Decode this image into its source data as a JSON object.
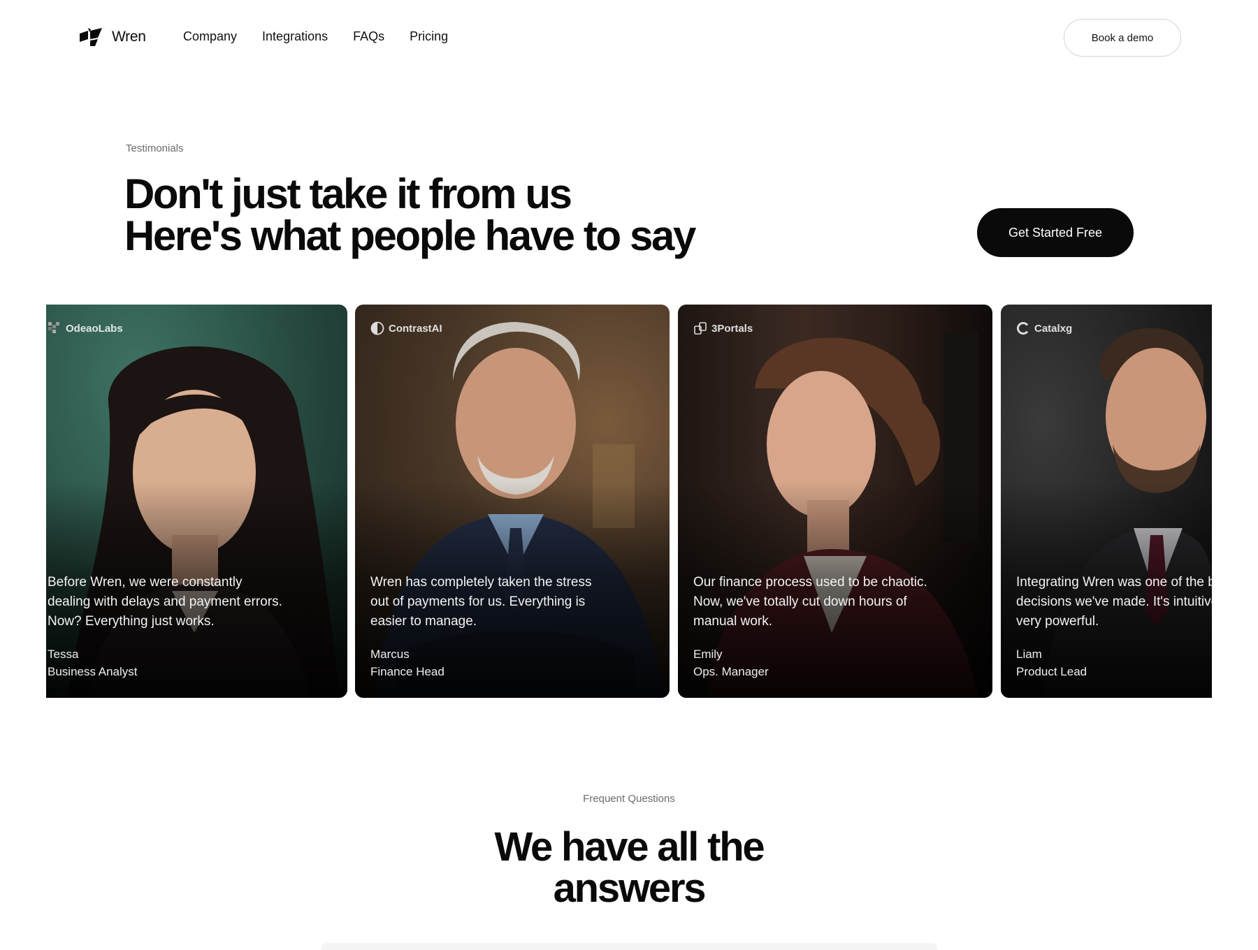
{
  "nav": {
    "brand": "Wren",
    "links": [
      "Company",
      "Integrations",
      "FAQs",
      "Pricing"
    ],
    "demo_label": "Book a demo"
  },
  "testimonials": {
    "eyebrow": "Testimonials",
    "title_line1": "Don't just take it from us",
    "title_line2": "Here's what people have to say",
    "cta_label": "Get Started Free",
    "cards": [
      {
        "company": "OdeaoLabs",
        "quote": "Before Wren, we were constantly dealing with delays and payment errors. Now? Everything just works.",
        "name": "Tessa",
        "role": "Business Analyst",
        "accent": "#2d5a4c"
      },
      {
        "company": "ContrastAI",
        "quote": "Wren has completely taken the stress out of payments for us. Everything is easier to manage.",
        "name": "Marcus",
        "role": "Finance Head",
        "accent": "#4a3a2c"
      },
      {
        "company": "3Portals",
        "quote": "Our finance process used to be chaotic. Now, we've totally cut down hours of manual work.",
        "name": "Emily",
        "role": "Ops. Manager",
        "accent": "#3b2420"
      },
      {
        "company": "Catalxg",
        "quote": "Integrating Wren was one of the best decisions we've made. It's intuitive and very powerful.",
        "name": "Liam",
        "role": "Product Lead",
        "accent": "#2a2a2a"
      }
    ]
  },
  "faq": {
    "eyebrow": "Frequent Questions",
    "title_line1": "We have all the",
    "title_line2": "answers"
  }
}
